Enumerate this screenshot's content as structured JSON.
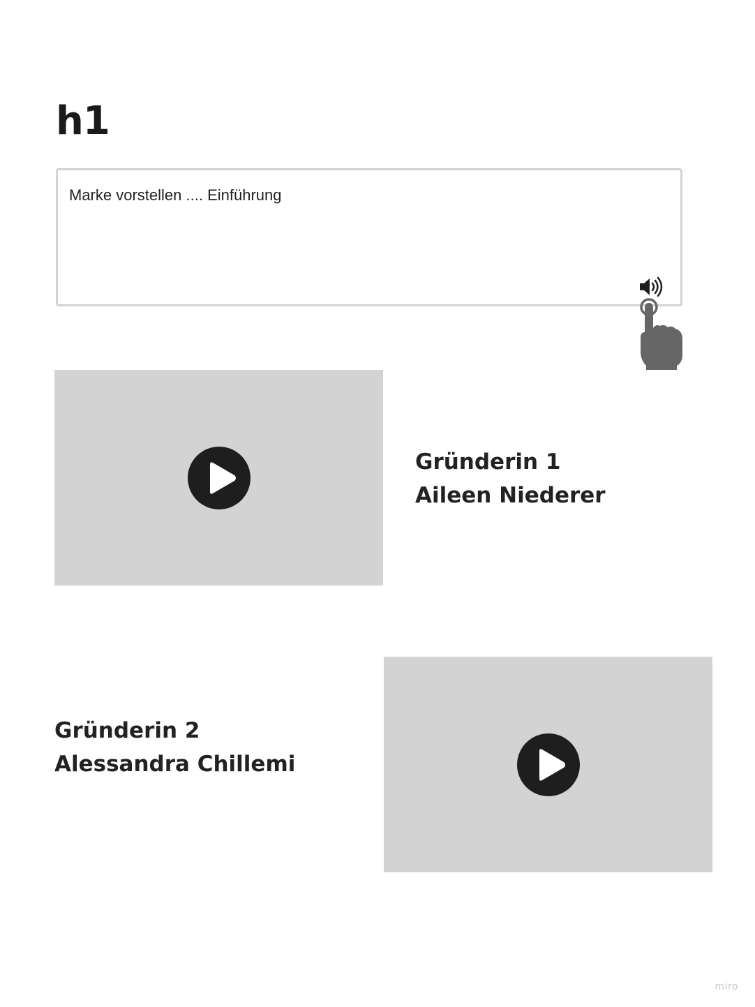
{
  "page": {
    "heading": "h1"
  },
  "textbox": {
    "text": "Marke vorstellen .... Einführung",
    "speaker_icon": "speaker-volume-icon",
    "pointer_icon": "hand-pointer-icon"
  },
  "founders": [
    {
      "title": "Gründerin 1",
      "name": "Aileen Niederer",
      "video_icon": "play-icon"
    },
    {
      "title": "Gründerin 2",
      "name": "Alessandra Chillemi",
      "video_icon": "play-icon"
    }
  ],
  "watermark": "miro",
  "colors": {
    "video_placeholder": "#d3d3d3",
    "play_button": "#1e1e1e",
    "pointer": "#666666",
    "textbox_border": "#d3d3d3"
  }
}
